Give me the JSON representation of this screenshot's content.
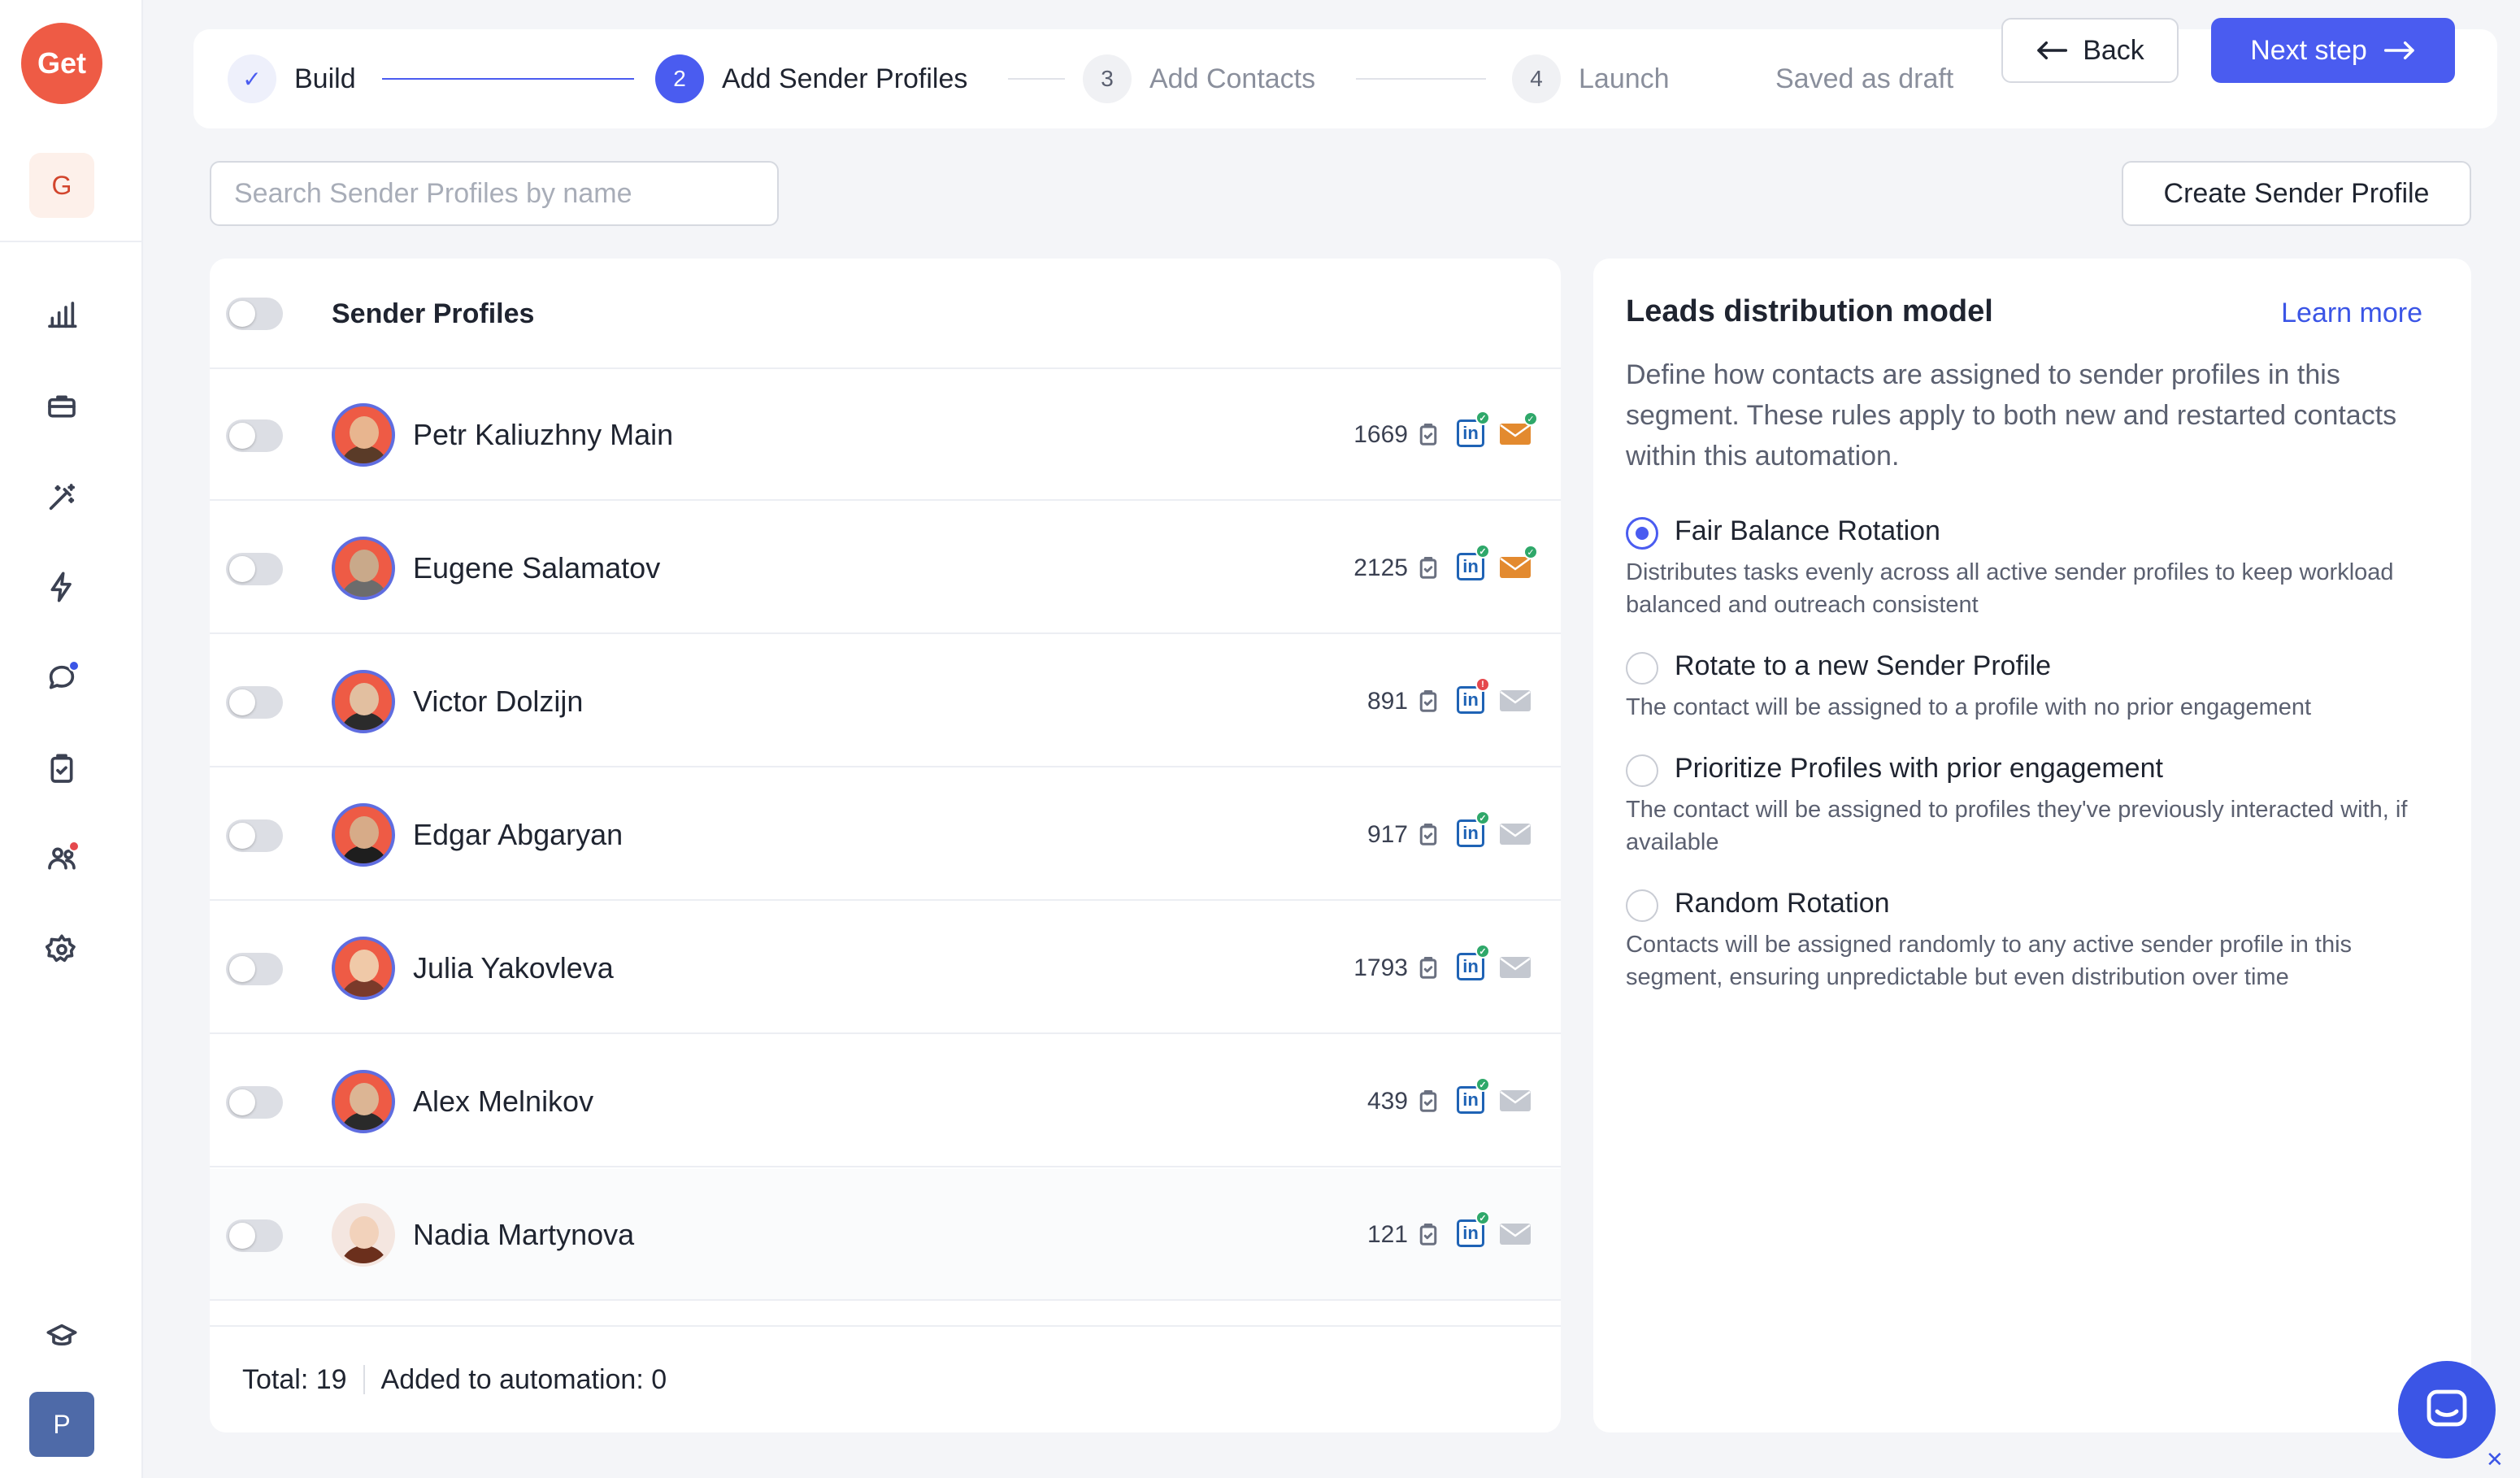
{
  "sidebar": {
    "logo": "Get",
    "workspace_initial": "G",
    "user_initial": "P",
    "accent_dot_blue": "#3b55e6",
    "accent_dot_red": "#e5484d"
  },
  "stepper": {
    "steps": [
      {
        "number": "✓",
        "label": "Build"
      },
      {
        "number": "2",
        "label": "Add Sender Profiles"
      },
      {
        "number": "3",
        "label": "Add Contacts"
      },
      {
        "number": "4",
        "label": "Launch"
      }
    ],
    "saved_status": "Saved as draft",
    "back_label": "Back",
    "next_label": "Next step"
  },
  "search": {
    "placeholder": "Search Sender Profiles by name",
    "value": ""
  },
  "create_button": "Create Sender Profile",
  "profiles": {
    "header": "Sender Profiles",
    "rows": [
      {
        "name": "Petr Kaliuzhny Main",
        "count": "1669"
      },
      {
        "name": "Eugene Salamatov",
        "count": "2125"
      },
      {
        "name": "Victor Dolzijn",
        "count": "891"
      },
      {
        "name": "Edgar Abgaryan",
        "count": "917"
      },
      {
        "name": "Julia Yakovleva",
        "count": "1793"
      },
      {
        "name": "Alex Melnikov",
        "count": "439"
      },
      {
        "name": "Nadia Martynova",
        "count": "121"
      }
    ],
    "footer_total": "Total: 19",
    "footer_added": "Added to automation: 0"
  },
  "distribution": {
    "title": "Leads distribution model",
    "learn_more": "Learn more",
    "description": "Define how contacts are assigned to sender profiles in this segment. These rules apply to both new and restarted contacts within this automation.",
    "options": [
      {
        "title": "Fair Balance Rotation",
        "desc": "Distributes tasks evenly across all active sender profiles to keep workload balanced and outreach consistent",
        "selected": true
      },
      {
        "title": "Rotate to a new Sender Profile",
        "desc": "The contact will be assigned to a profile with no prior engagement",
        "selected": false
      },
      {
        "title": "Prioritize Profiles with prior engagement",
        "desc": "The contact will be assigned to profiles they've previously interacted with, if available",
        "selected": false
      },
      {
        "title": "Random Rotation",
        "desc": "Contacts will be assigned randomly to any active sender profile in this segment, ensuring unpredictable but even distribution over time",
        "selected": false
      }
    ]
  },
  "colors": {
    "primary": "#4a5cf0",
    "logo": "#ee5b45",
    "success": "#2fa86a",
    "error": "#e5484d",
    "linkedin": "#1f63b5",
    "mail_active": "#e38a2f",
    "mail_inactive": "#c4c8d0"
  }
}
